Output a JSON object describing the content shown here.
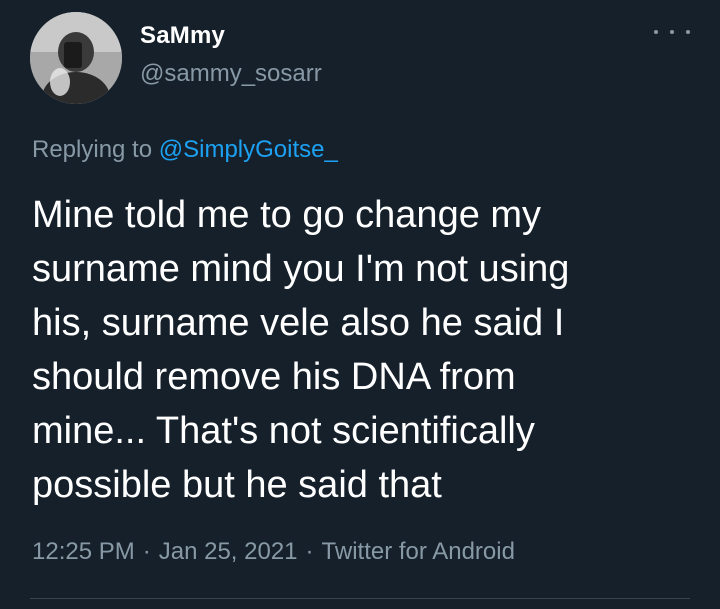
{
  "user": {
    "display_name": "SaMmy",
    "handle": "@sammy_sosarr"
  },
  "reply": {
    "prefix": "Replying to ",
    "mention": "@SimplyGoitse_"
  },
  "tweet": {
    "text": "Mine told me to go change my\nsurname mind you I'm not using\nhis, surname vele also he said I\nshould remove his DNA from\nmine... That's not scientifically\npossible but he said that"
  },
  "meta": {
    "time": "12:25 PM",
    "separator": "·",
    "date": "Jan 25, 2021",
    "source": "Twitter for Android"
  },
  "icons": {
    "avatar": "profile-photo",
    "more": "more-options-icon"
  },
  "colors": {
    "background": "#15202b",
    "primary_text": "#ffffff",
    "secondary_text": "#8899a6",
    "accent": "#1da1f2"
  }
}
